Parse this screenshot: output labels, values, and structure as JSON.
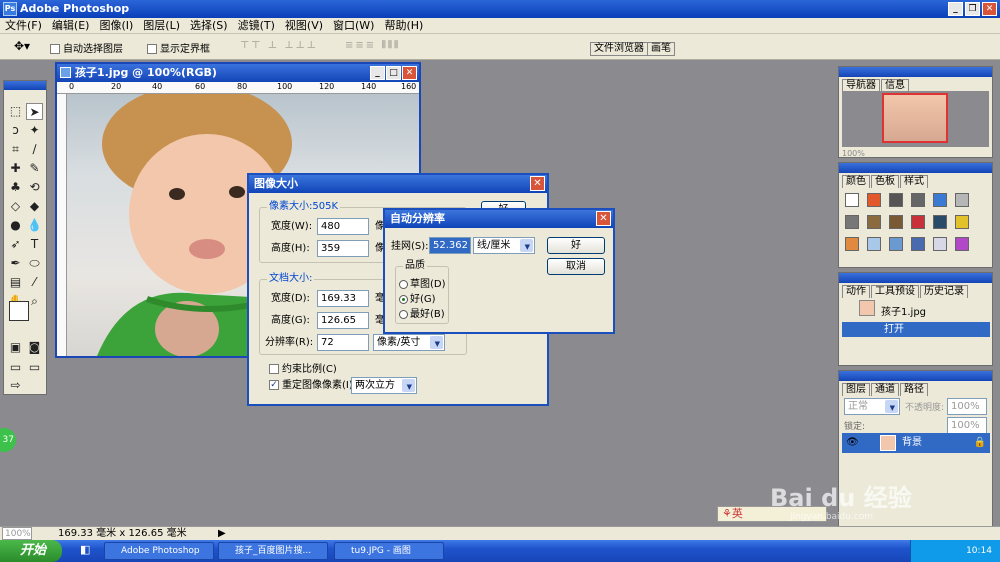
{
  "app_title": "Adobe Photoshop",
  "menu": [
    "文件(F)",
    "编辑(E)",
    "图像(I)",
    "图层(L)",
    "选择(S)",
    "滤镜(T)",
    "视图(V)",
    "窗口(W)",
    "帮助(H)"
  ],
  "options": {
    "auto_select": "自动选择图层",
    "show_bbox": "显示定界框"
  },
  "well_tabs": [
    "文件浏览器",
    "画笔"
  ],
  "document": {
    "title": "孩子1.jpg @ 100%(RGB)",
    "ruler_marks": [
      "0",
      "20",
      "40",
      "60",
      "80",
      "100",
      "120",
      "140",
      "160"
    ]
  },
  "image_size": {
    "title": "图像大小",
    "pixel_dims": "像素大小:505K",
    "width_label": "宽度(W):",
    "width_value": "480",
    "width_unit": "像",
    "height_label": "高度(H):",
    "height_value": "359",
    "height_unit": "像",
    "doc_size": "文档大小:",
    "dwidth_label": "宽度(D):",
    "dwidth_value": "169.33",
    "dwidth_unit": "毫",
    "dheight_label": "高度(G):",
    "dheight_value": "126.65",
    "dheight_unit": "毫",
    "res_label": "分辨率(R):",
    "res_value": "72",
    "res_unit": "像素/英寸",
    "constrain": "约束比例(C)",
    "resample": "重定图像像素(I):",
    "resample_method": "两次立方",
    "ok": "好"
  },
  "auto_res": {
    "title": "自动分辨率",
    "screen_label": "挂网(S):",
    "screen_value": "52.362",
    "screen_unit": "线/厘米",
    "ok": "好",
    "cancel": "取消",
    "quality_label": "品质",
    "draft": "草图(D)",
    "good": "好(G)",
    "best": "最好(B)"
  },
  "panels": {
    "nav_tabs": [
      "导航器",
      "信息"
    ],
    "nav_zoom": "100%",
    "color_tabs": [
      "颜色",
      "色板",
      "样式"
    ],
    "history_tabs": [
      "动作",
      "工具预设",
      "历史记录"
    ],
    "history_doc": "孩子1.jpg",
    "history_open": "打开",
    "layers_tabs": [
      "图层",
      "通道",
      "路径"
    ],
    "blend_mode": "正常",
    "opacity_label": "不透明度:",
    "opacity_value": "100%",
    "lock_label": "锁定:",
    "fill_value": "100%",
    "layer_name": "背景"
  },
  "status": {
    "zoom": "100%",
    "doc_size": "169.33 毫米 x 126.65 毫米"
  },
  "ime": "英",
  "watermark": "Bai du 经验",
  "watermark_url": "jingyan.baidu.com",
  "badge": "37",
  "taskbar": {
    "start": "开始",
    "tasks": [
      "Adobe Photoshop",
      "孩子_百度图片搜...",
      "tu9.JPG - 画图"
    ],
    "clock": "10:14"
  }
}
